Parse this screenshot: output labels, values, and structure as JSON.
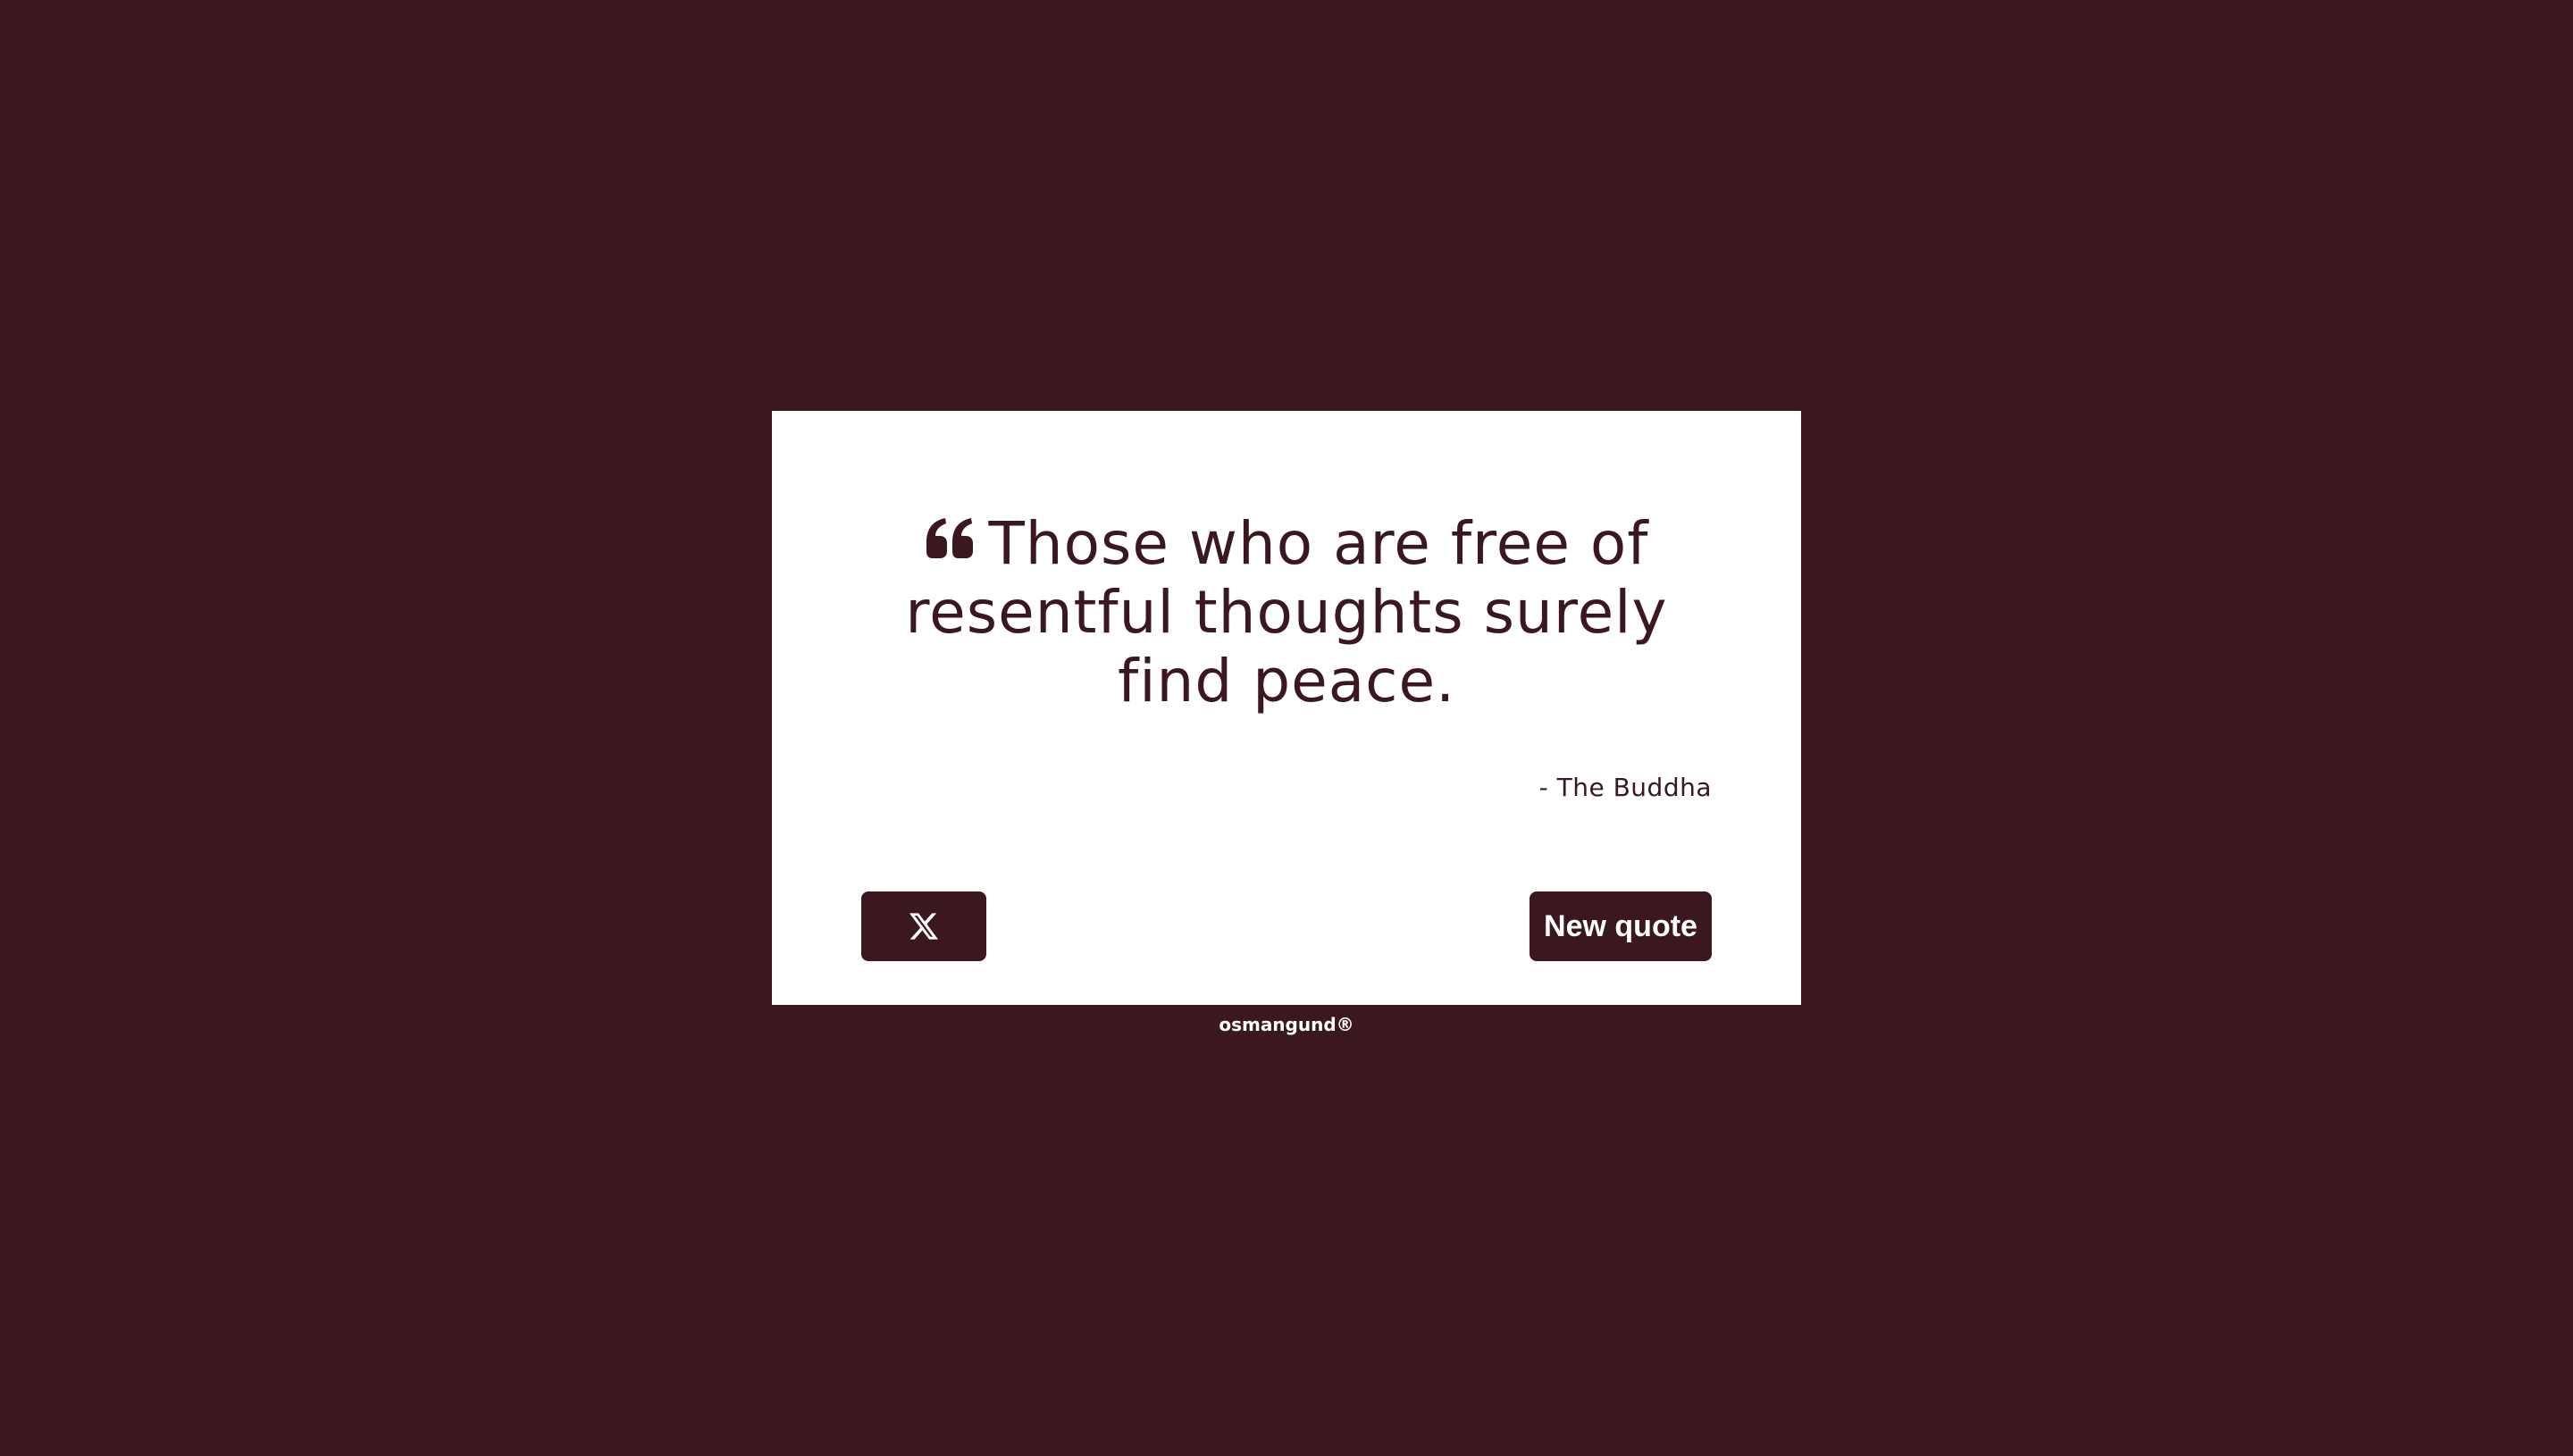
{
  "colors": {
    "background": "#3b1820",
    "card": "#ffffff",
    "accent": "#3b1820",
    "button_text": "#ffffff"
  },
  "quote": {
    "icon": "quote-left-icon",
    "text": "Those who are free of resentful thoughts surely find peace.",
    "author": "- The Buddha"
  },
  "buttons": {
    "tweet_icon": "x-logo-icon",
    "new_quote_label": "New quote"
  },
  "footer": {
    "credit": "osmangund®"
  }
}
